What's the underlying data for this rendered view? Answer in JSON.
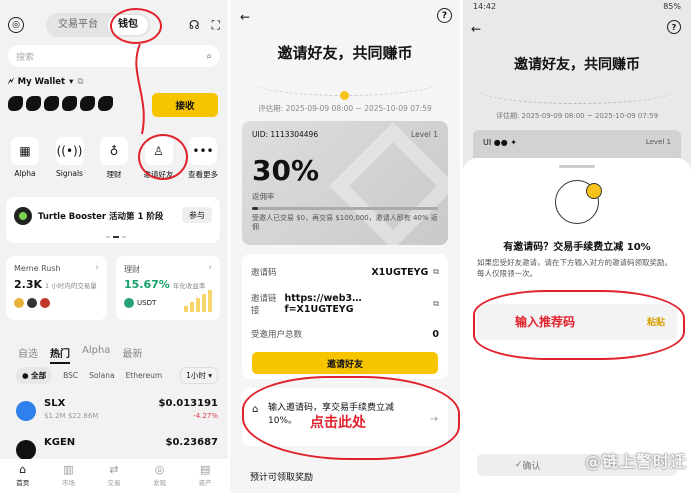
{
  "panel1": {
    "tabs": [
      "交易平台",
      "钱包"
    ],
    "active_tab": "钱包",
    "search_placeholder": "搜索",
    "wallet_name": "My Wallet",
    "collect_label": "接收",
    "quick_actions": [
      {
        "label": "Alpha",
        "icon": "calendar-icon"
      },
      {
        "label": "Signals",
        "icon": "signal-icon"
      },
      {
        "label": "理财",
        "icon": "moneybag-icon"
      },
      {
        "label": "邀请好友",
        "icon": "person-icon"
      },
      {
        "label": "查看更多",
        "icon": "more-icon"
      }
    ],
    "booster": {
      "title": "Turtle Booster 活动第 1 阶段",
      "button": "参与"
    },
    "meme": {
      "title": "Meme Rush",
      "value": "2.3K",
      "sub": "1 小时内的交易量"
    },
    "licai": {
      "title": "理财",
      "value": "15.67%",
      "sub": "年化收益率",
      "coin": "USDT"
    },
    "list_tabs": [
      "自选",
      "热门",
      "Alpha",
      "最新"
    ],
    "active_list_tab": "热门",
    "chips": [
      "全部",
      "BSC",
      "Solana",
      "Ethereum"
    ],
    "interval": "1小时 ▾",
    "tokens": [
      {
        "name": "SLX",
        "sub": "$1.2M    $22.86M",
        "price": "$0.013191",
        "change": "-4.27%",
        "color": "#2f80ed"
      },
      {
        "name": "KGEN",
        "sub": "",
        "price": "$0.23687",
        "change": "",
        "color": "#111111"
      }
    ],
    "nav": [
      {
        "label": "首页",
        "icon": "home-icon",
        "on": true
      },
      {
        "label": "市场",
        "icon": "chart-icon",
        "on": false
      },
      {
        "label": "交易",
        "icon": "swap-icon",
        "on": false
      },
      {
        "label": "发现",
        "icon": "compass-icon",
        "on": false
      },
      {
        "label": "资产",
        "icon": "wallet-icon",
        "on": false
      }
    ]
  },
  "panel2": {
    "title": "邀请好友，共同赚币",
    "period": "评估期: 2025-09-09 08:00 ~ 2025-10-09 07:59",
    "uid": "UID: 1113304496",
    "level": "Level 1",
    "rebate_pct": "30%",
    "rebate_label": "返佣率",
    "progress_fraction": 0.0,
    "note": "受邀人已交易 $0，再交易 $100,000，邀请人即有 40% 返佣",
    "code_label": "邀请码",
    "code_value": "X1UGTEYG",
    "link_label": "邀请链接",
    "link_value": "https://web3…f=X1UGTEYG",
    "invitees_label": "受邀用户总数",
    "invitees_value": "0",
    "invite_button": "邀请好友",
    "enter_code": "输入邀请码，享交易手续费立减 10%。",
    "annotation": "点击此处",
    "estimate_label": "预计可领取奖励"
  },
  "panel3": {
    "time": "14:42",
    "battery": "85%",
    "title": "邀请好友，共同赚币",
    "period": "评估期: 2025-09-09 08:00 ~ 2025-10-09 07:59",
    "uid_prefix": "UI",
    "level": "Level 1",
    "sheet_title": "有邀请码？交易手续费立减 10%",
    "sheet_desc": "如果您受好友邀请，请在下方输入对方的邀请码领取奖励。每人仅限领一次。",
    "input_placeholder": "输入推荐码",
    "paste_label": "粘贴",
    "confirm_label": "确认",
    "watermark": "@链上警时迁"
  }
}
